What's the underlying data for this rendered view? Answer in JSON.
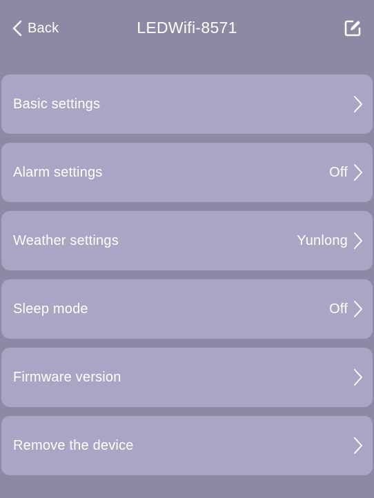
{
  "header": {
    "back_label": "Back",
    "title": "LEDWifi-8571",
    "back_icon": "chevron-left-icon",
    "edit_icon": "edit-icon"
  },
  "settings": {
    "items": [
      {
        "label": "Basic settings",
        "value": ""
      },
      {
        "label": "Alarm settings",
        "value": "Off"
      },
      {
        "label": "Weather settings",
        "value": "Yunlong"
      },
      {
        "label": "Sleep mode",
        "value": "Off"
      },
      {
        "label": "Firmware version",
        "value": ""
      },
      {
        "label": "Remove the device",
        "value": ""
      }
    ]
  },
  "colors": {
    "background": "#8d88a3",
    "row_background": "#aaa5c4",
    "text": "#ffffff"
  }
}
